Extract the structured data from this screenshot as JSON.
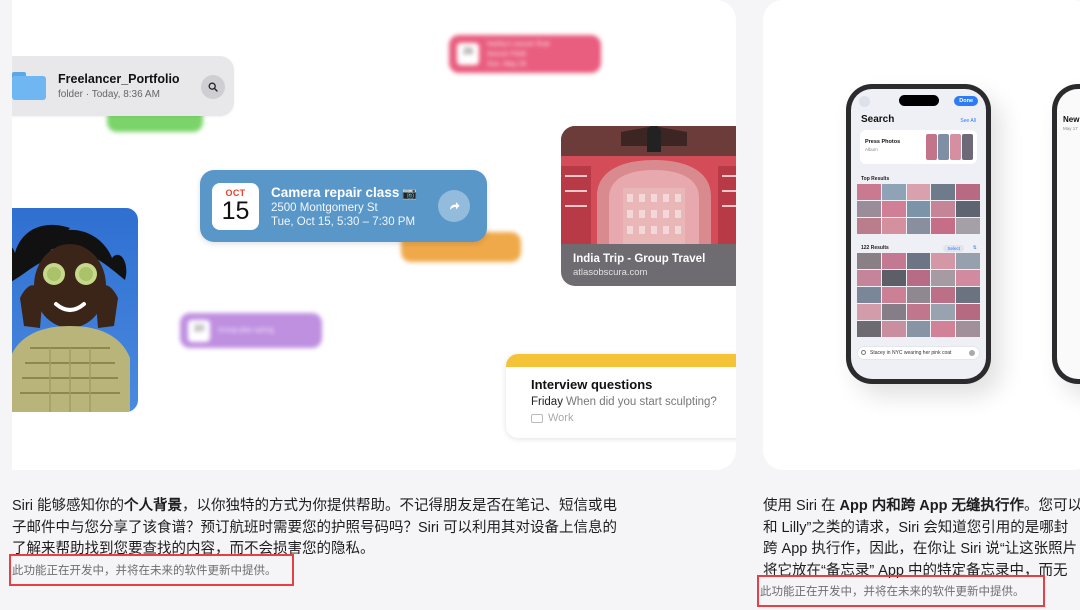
{
  "left_card": {
    "blurred_notes": {
      "pink_title": "Harley's soccer final",
      "pink_date": "26",
      "pink_sub": "Soccer Field",
      "pink_time": "Sun, May 26",
      "purple_title": "Group plan spring",
      "purple_date": "10"
    },
    "file": {
      "name": "Freelancer_Portfolio",
      "meta": "folder · Today, 8:36 AM"
    },
    "event": {
      "month": "OCT",
      "day": "15",
      "title": "Camera repair class",
      "title_emoji": "📷",
      "address": "2500 Montgomery St",
      "time": "Tue, Oct 15, 5:30 – 7:30 PM"
    },
    "link": {
      "title": "India Trip - Group Travel",
      "url": "atlasobscura.com"
    },
    "notes": {
      "heading": "Interview questions",
      "day": "Friday",
      "question": "When did you start sculpting?",
      "folder": "Work"
    }
  },
  "right_card": {
    "phone": {
      "done": "Done",
      "title": "Search",
      "see_all": "See All",
      "press_title": "Press Photos",
      "press_sub": "Album",
      "top_results": "Top Results",
      "results_count": "122 Results",
      "select": "Select",
      "search_text": "Stacey in NYC wearing her pink coat"
    },
    "partial_phone": {
      "title": "New",
      "sub": "May 17"
    }
  },
  "descriptions": {
    "left_pre": "Siri 能够感知你的",
    "left_bold": "个人背景",
    "left_post": "，以你独特的方式为你提供帮助。不记得朋友是否在笔记、短信或电子邮件中与您分享了该食谱？预订航班时需要您的护照号码吗？Siri 可以利用其对设备上信息的了解来帮助找到您要查找的内容，而不会损害您的隐私。",
    "left_notice": "此功能正在开发中，并将在未来的软件更新中提供。",
    "right_line1_pre": "使用 Siri 在 ",
    "right_line1_bold": "App 内和跨 App 无缝执行作",
    "right_line1_post": "。您可以",
    "right_line2": "和 Lilly”之类的请求，Siri 会知道您引用的是哪封",
    "right_line3": "跨 App 执行作，因此，在你让 Siri 说“让这张照片",
    "right_line4": "将它放在“备忘录” App 中的特定备忘录中，而无",
    "right_notice": "此功能正在开发中，并将在未来的软件更新中提供。"
  },
  "colors": {
    "event_blue": "#5a97c9",
    "notice_border": "#e64045",
    "notes_yellow": "#f4c338",
    "accent_blue": "#2d7cf6"
  }
}
